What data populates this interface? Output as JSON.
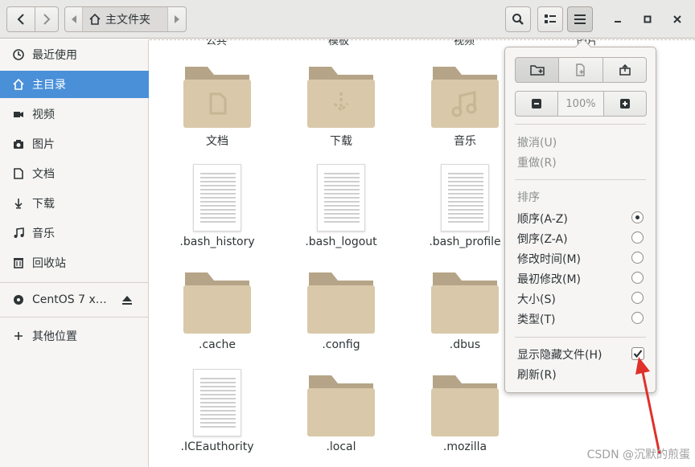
{
  "header": {
    "path_label": "主文件夹"
  },
  "sidebar": {
    "items": [
      {
        "label": "最近使用",
        "icon": "clock-icon"
      },
      {
        "label": "主目录",
        "icon": "home-icon"
      },
      {
        "label": "视频",
        "icon": "video-icon"
      },
      {
        "label": "图片",
        "icon": "camera-icon"
      },
      {
        "label": "文档",
        "icon": "document-icon"
      },
      {
        "label": "下载",
        "icon": "download-icon"
      },
      {
        "label": "音乐",
        "icon": "music-icon"
      },
      {
        "label": "回收站",
        "icon": "trash-icon"
      },
      {
        "label": "CentOS 7 x…",
        "icon": "disc-icon"
      },
      {
        "label": "其他位置",
        "icon": "plus-icon"
      }
    ]
  },
  "main": {
    "top_clipped": [
      "公共",
      "模板",
      "视频",
      "图片"
    ],
    "files": [
      {
        "name": "文档",
        "type": "folder"
      },
      {
        "name": "下载",
        "type": "folder"
      },
      {
        "name": "音乐",
        "type": "folder"
      },
      {
        "name": ".bash_history",
        "type": "file"
      },
      {
        "name": ".bash_logout",
        "type": "file"
      },
      {
        "name": ".bash_profile",
        "type": "file"
      },
      {
        "name": ".cache",
        "type": "folder"
      },
      {
        "name": ".config",
        "type": "folder"
      },
      {
        "name": ".dbus",
        "type": "folder"
      },
      {
        "name": ".ICEauthority",
        "type": "file"
      },
      {
        "name": ".local",
        "type": "folder"
      },
      {
        "name": ".mozilla",
        "type": "folder"
      }
    ]
  },
  "menu": {
    "zoom_level": "100%",
    "undo": "撤消(U)",
    "redo": "重做(R)",
    "sort_heading": "排序",
    "sort_options": [
      {
        "label": "顺序(A-Z)",
        "selected": true
      },
      {
        "label": "倒序(Z-A)",
        "selected": false
      },
      {
        "label": "修改时间(M)",
        "selected": false
      },
      {
        "label": "最初修改(M)",
        "selected": false
      },
      {
        "label": "大小(S)",
        "selected": false
      },
      {
        "label": "类型(T)",
        "selected": false
      }
    ],
    "show_hidden": "显示隐藏文件(H)",
    "show_hidden_checked": true,
    "refresh": "刷新(R)"
  },
  "watermark": "CSDN @沉默的煎蛋",
  "colors": {
    "accent": "#4a90d9",
    "folder": "#d9c8a9",
    "annotation_arrow": "#e0302a"
  }
}
